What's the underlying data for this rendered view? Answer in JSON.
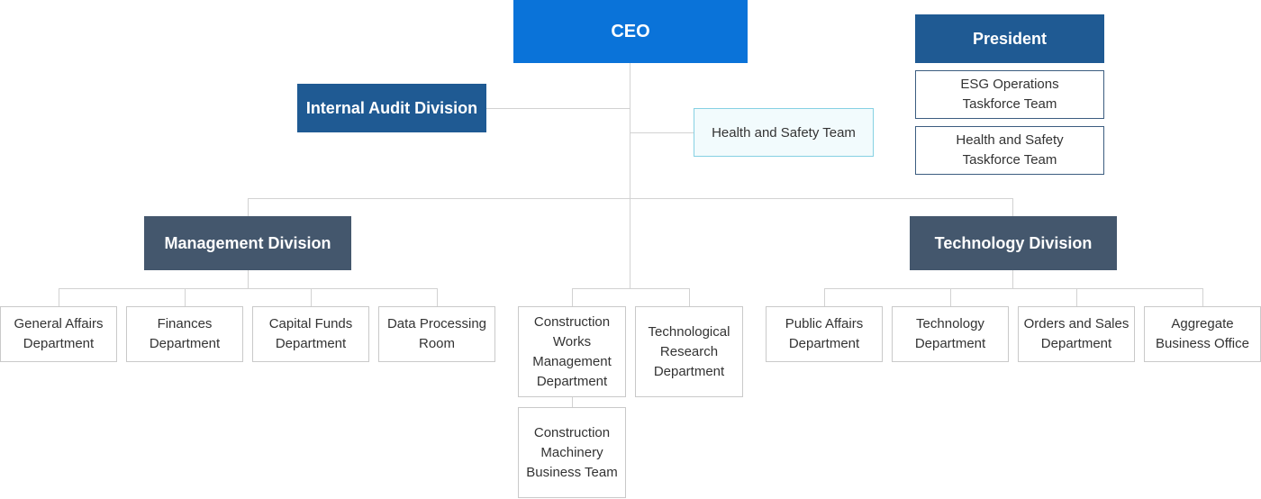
{
  "chart": {
    "ceo": "CEO",
    "president": "President",
    "internal_audit": "Internal Audit Division",
    "health_safety_team": "Health and Safety Team",
    "esg_taskforce": [
      "ESG Operations",
      "Taskforce Team"
    ],
    "hs_taskforce": [
      "Health and Safety",
      "Taskforce Team"
    ],
    "management_division": "Management Division",
    "technology_division": "Technology Division",
    "management_departments": [
      [
        "General Affairs",
        "Department"
      ],
      [
        "Finances",
        "Department"
      ],
      [
        "Capital Funds",
        "Department"
      ],
      [
        "Data Processing",
        "Room"
      ]
    ],
    "construction_works": [
      "Construction",
      "Works",
      "Management",
      "Department"
    ],
    "construction_machinery": [
      "Construction",
      "Machinery",
      "Business Team"
    ],
    "tech_research": [
      "Technological",
      "Research",
      "Department"
    ],
    "technology_departments": [
      [
        "Public Affairs",
        "Department"
      ],
      [
        "Technology",
        "Department"
      ],
      [
        "Orders and Sales",
        "Department"
      ],
      [
        "Aggregate",
        "Business Office"
      ]
    ]
  },
  "colors": {
    "ceo": "#0a73d9",
    "navy": "#1f5a93",
    "slate": "#44576d",
    "light_fill": "#f2fbfd",
    "light_border": "#86d1e3",
    "connector": "#d2d2d2"
  }
}
